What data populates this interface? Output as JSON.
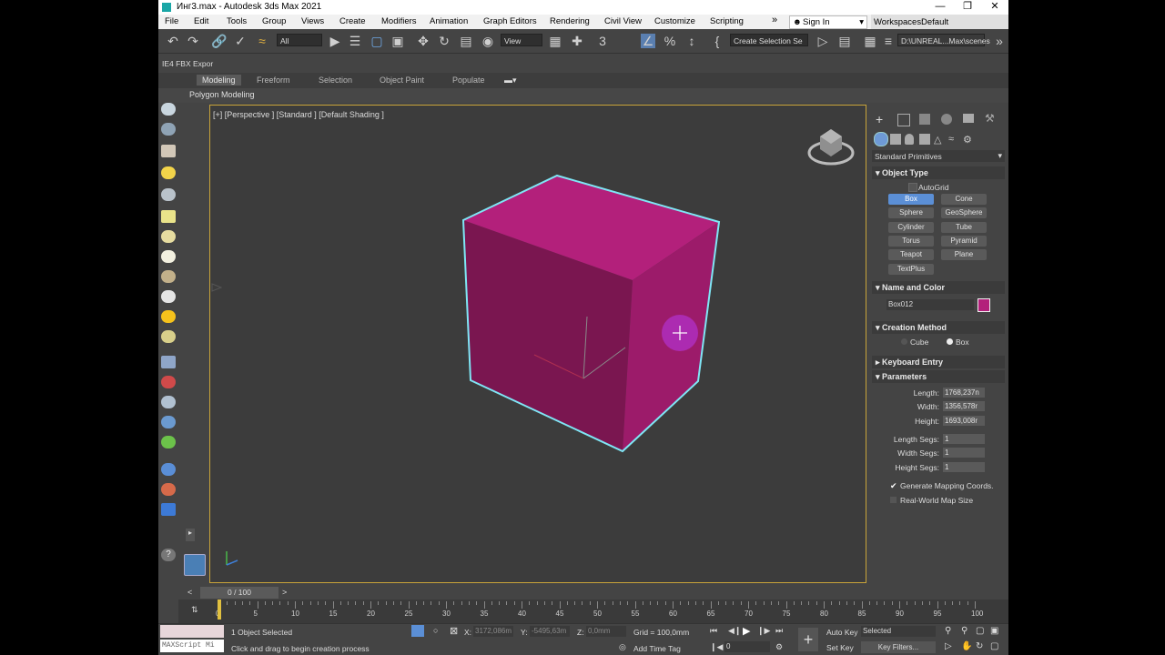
{
  "window": {
    "title": "Инг3.max - Autodesk 3ds Max 2021"
  },
  "menu": {
    "items": [
      "File",
      "Edit",
      "Tools",
      "Group",
      "Views",
      "Create",
      "Modifiers",
      "Animation",
      "Graph Editors",
      "Rendering",
      "Civil View",
      "Customize",
      "Scripting"
    ],
    "sign_in": "Sign In",
    "workspaces_label": "Workspaces:",
    "workspaces_value": "Default"
  },
  "toolbar": {
    "filter": "All",
    "view": "View",
    "create_selection_set": "Create Selection Se",
    "path": "D:\\UNREAL...Max\\scenes"
  },
  "fbx_label": "IE4 FBX Expor",
  "ribbon": {
    "tabs": [
      "Modeling",
      "Freeform",
      "Selection",
      "Object Paint",
      "Populate"
    ],
    "sub": "Polygon Modeling"
  },
  "viewport": {
    "label": "[+] [Perspective ] [Standard ] [Default Shading ]",
    "object_color": "#b3207b",
    "selection_color": "#7fe6f5"
  },
  "panel": {
    "category": "Standard Primitives",
    "object_type": "Object Type",
    "autogrid": "AutoGrid",
    "buttons": [
      "Box",
      "Cone",
      "Sphere",
      "GeoSphere",
      "Cylinder",
      "Tube",
      "Torus",
      "Pyramid",
      "Teapot",
      "Plane",
      "TextPlus"
    ],
    "selected_button": "Box",
    "name_and_color": "Name and Color",
    "object_name": "Box012",
    "swatch_color": "#b3207b",
    "creation_method": "Creation Method",
    "cube": "Cube",
    "box": "Box",
    "keyboard_entry": "Keyboard Entry",
    "parameters": "Parameters",
    "length_label": "Length:",
    "length": "1768,237n",
    "width_label": "Width:",
    "width": "1356,578r",
    "height_label": "Height:",
    "height": "1693,008r",
    "length_segs_label": "Length Segs:",
    "length_segs": "1",
    "width_segs_label": "Width Segs:",
    "width_segs": "1",
    "height_segs_label": "Height Segs:",
    "height_segs": "1",
    "gen_mapping": "Generate Mapping Coords.",
    "real_world": "Real-World Map Size"
  },
  "timeline": {
    "frame": "0 / 100",
    "ticks": [
      "0",
      "5",
      "10",
      "15",
      "20",
      "25",
      "30",
      "35",
      "40",
      "45",
      "50",
      "55",
      "60",
      "65",
      "70",
      "75",
      "80",
      "85",
      "90",
      "95",
      "100"
    ]
  },
  "status": {
    "selected": "1 Object Selected",
    "prompt": "Click and drag to begin creation process",
    "maxscript": "MAXScript Mi",
    "x_label": "X:",
    "x": "3172,086m",
    "y_label": "Y:",
    "y": "-5495,63m",
    "z_label": "Z:",
    "z": "0,0mm",
    "grid": "Grid = 100,0mm",
    "add_time_tag": "Add Time Tag",
    "auto_key": "Auto Key",
    "selected_dd": "Selected",
    "set_key": "Set Key",
    "key_filters": "Key Filters...",
    "frame_field": "0"
  }
}
